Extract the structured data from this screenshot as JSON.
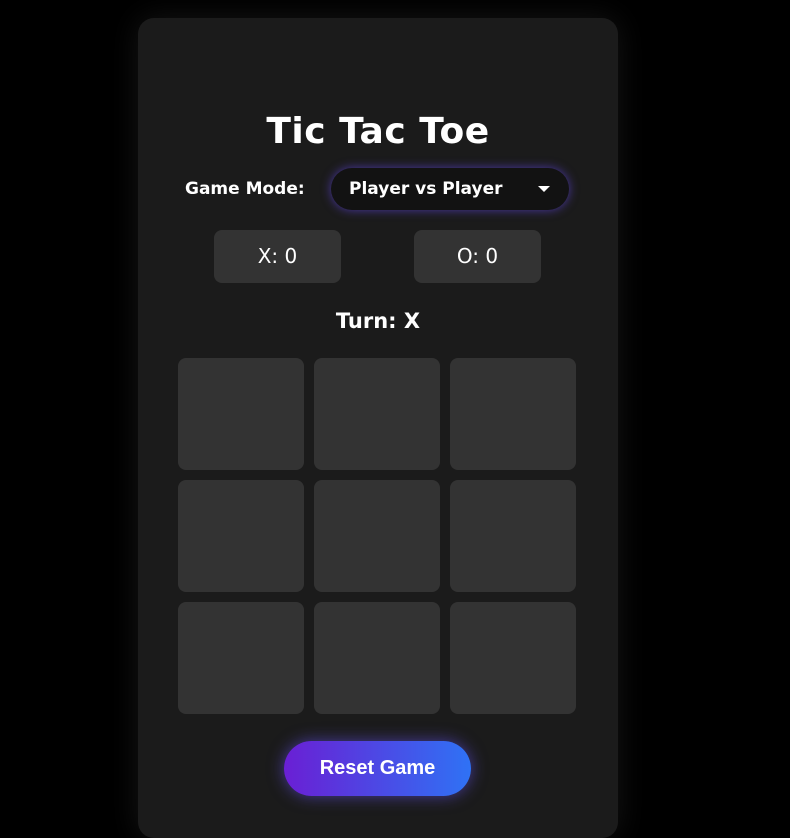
{
  "title": "Tic Tac Toe",
  "game_mode": {
    "label": "Game Mode:",
    "selected": "Player vs Player",
    "icon": "chevron-down-icon"
  },
  "scores": {
    "x": "X: 0",
    "o": "O: 0"
  },
  "turn": "Turn: X",
  "board": [
    "",
    "",
    "",
    "",
    "",
    "",
    "",
    "",
    ""
  ],
  "reset_label": "Reset Game",
  "colors": {
    "background": "#000000",
    "card": "#1b1b1b",
    "cell": "#333333",
    "accent_start": "#6a1fd4",
    "accent_end": "#2f72f5",
    "select_glow": "#6246ea"
  }
}
